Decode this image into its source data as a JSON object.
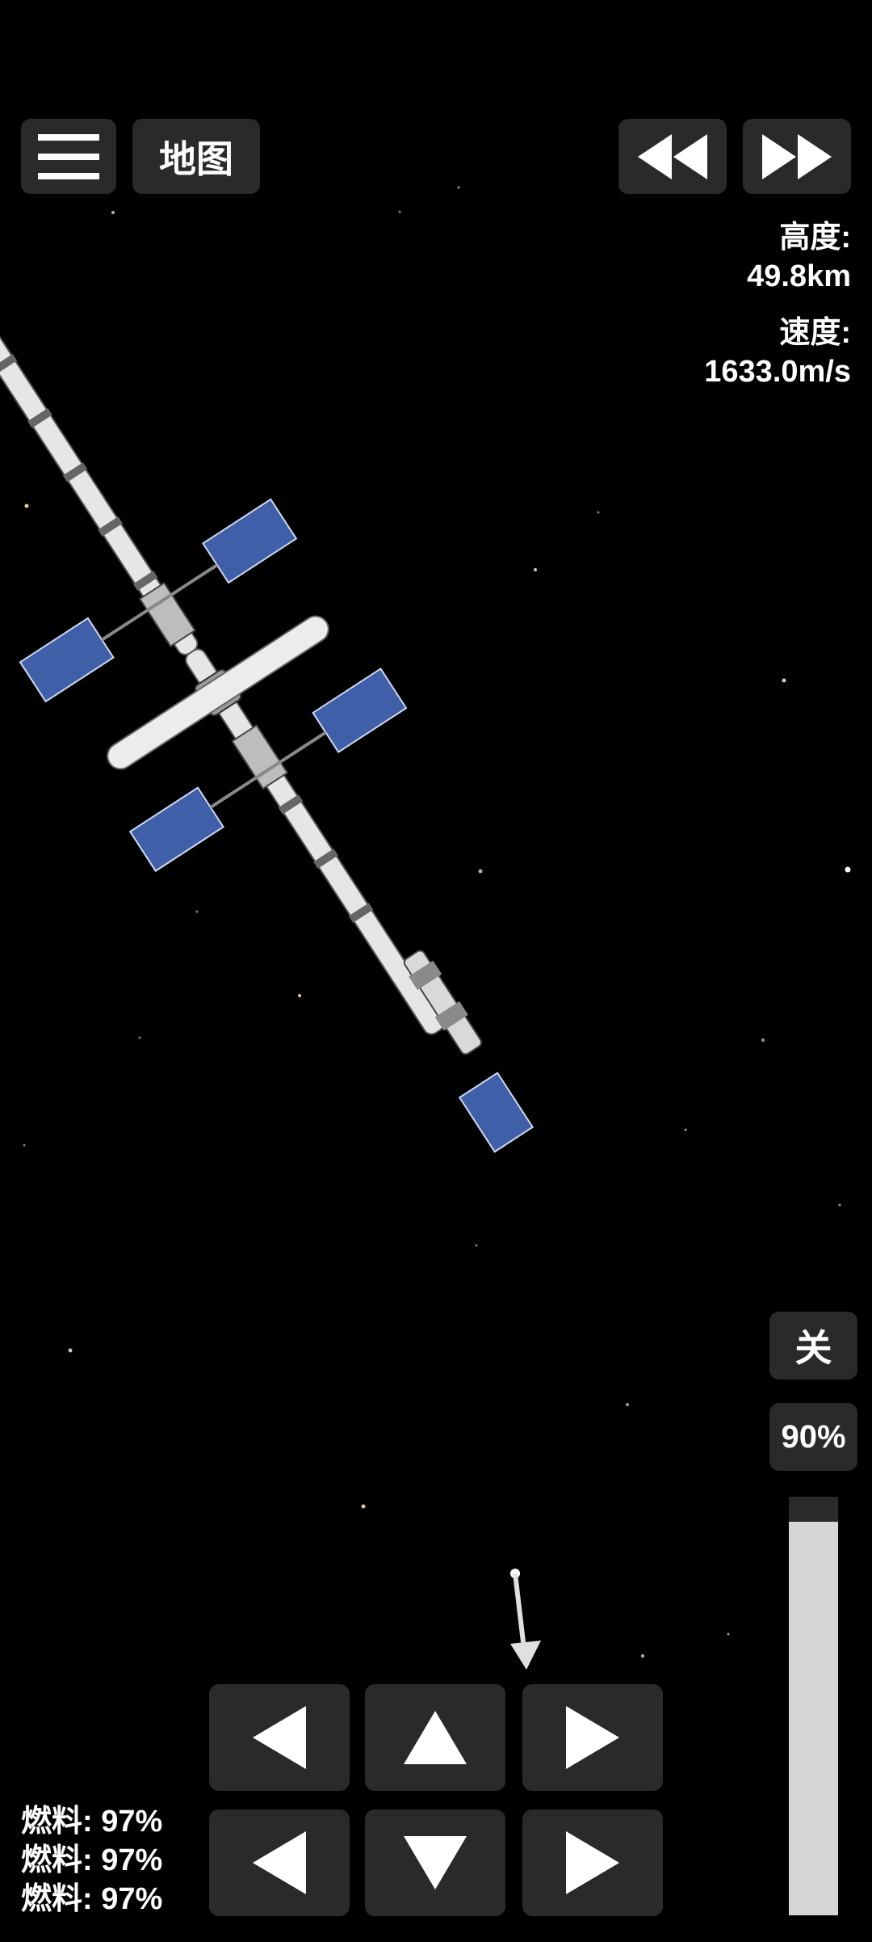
{
  "top_bar": {
    "menu_icon": "hamburger-icon",
    "map_label": "地图",
    "rewind_icon": "rewind-icon",
    "fast_forward_icon": "fast-forward-icon"
  },
  "telemetry": {
    "altitude_label": "高度:",
    "altitude_value": "49.8km",
    "speed_label": "速度:",
    "speed_value": "1633.0m/s"
  },
  "engine": {
    "toggle_label": "关",
    "throttle_label": "90%",
    "throttle_level": 0.94
  },
  "controls": {
    "left_icon": "arrow-left-icon",
    "up_icon": "arrow-up-icon",
    "right_icon": "arrow-right-icon",
    "down_icon": "arrow-down-icon"
  },
  "fuel": [
    "燃料: 97%",
    "燃料: 97%",
    "燃料: 97%"
  ],
  "colors": {
    "background": "#000000",
    "button": "#2a2a2a",
    "throttle_fill": "#d6d6d6",
    "solar_panel": "#3f5fa8",
    "module": "#e6e6e6"
  }
}
